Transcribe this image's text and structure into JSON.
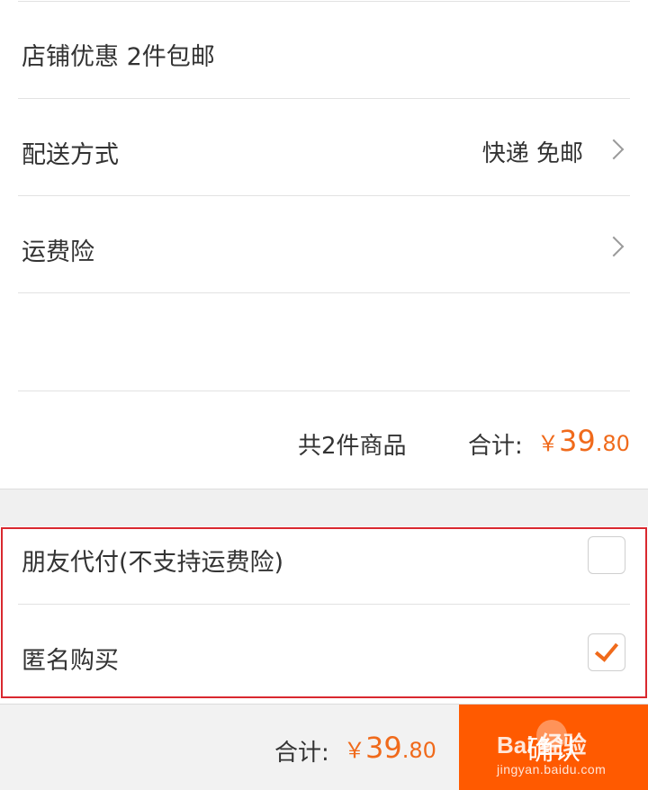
{
  "shop_discount": {
    "label": "店铺优惠 2件包邮"
  },
  "delivery": {
    "label": "配送方式",
    "value": "快递 免邮"
  },
  "shipping_insurance": {
    "label": "运费险"
  },
  "summary": {
    "count_text": "共2件商品",
    "total_label": "合计:",
    "price_symbol": "￥",
    "price_int": "39",
    "price_dec": ".80"
  },
  "options": {
    "friend_pay": {
      "label": "朋友代付(不支持运费险)",
      "checked": false
    },
    "anonymous": {
      "label": "匿名购买",
      "checked": true
    }
  },
  "footer": {
    "total_label": "合计:",
    "price_symbol": "￥",
    "price_int": "39",
    "price_dec": ".80",
    "confirm_label": "确认"
  },
  "watermark": {
    "brand": "Bai 经验",
    "url": "jingyan.baidu.com"
  },
  "colors": {
    "accent": "#f06a1b",
    "confirm_bg": "#ff5a00",
    "highlight_border": "#d9282f"
  }
}
